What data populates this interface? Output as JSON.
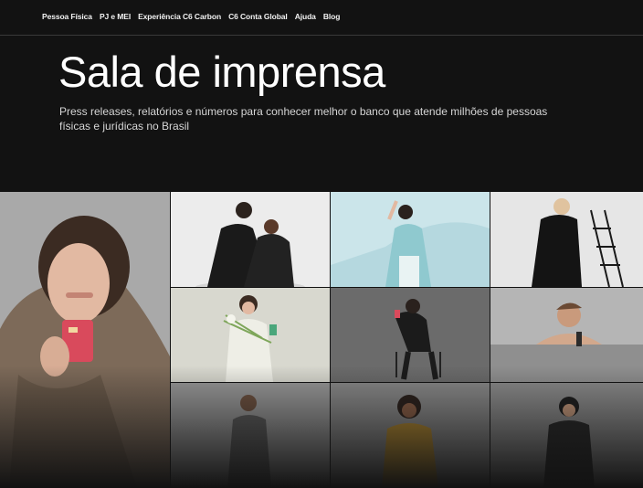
{
  "nav": {
    "items": [
      {
        "label": "Pessoa Física"
      },
      {
        "label": "PJ e MEI"
      },
      {
        "label": "Experiência C6 Carbon"
      },
      {
        "label": "C6 Conta Global"
      },
      {
        "label": "Ajuda"
      },
      {
        "label": "Blog"
      }
    ]
  },
  "hero": {
    "title": "Sala de imprensa",
    "subtitle": "Press releases, relatórios e números para conhecer melhor o banco que atende milhões de pessoas físicas e jurídicas no Brasil"
  },
  "colors": {
    "background": "#121212",
    "text": "#ffffff",
    "card_accent": "#d94a5c"
  }
}
